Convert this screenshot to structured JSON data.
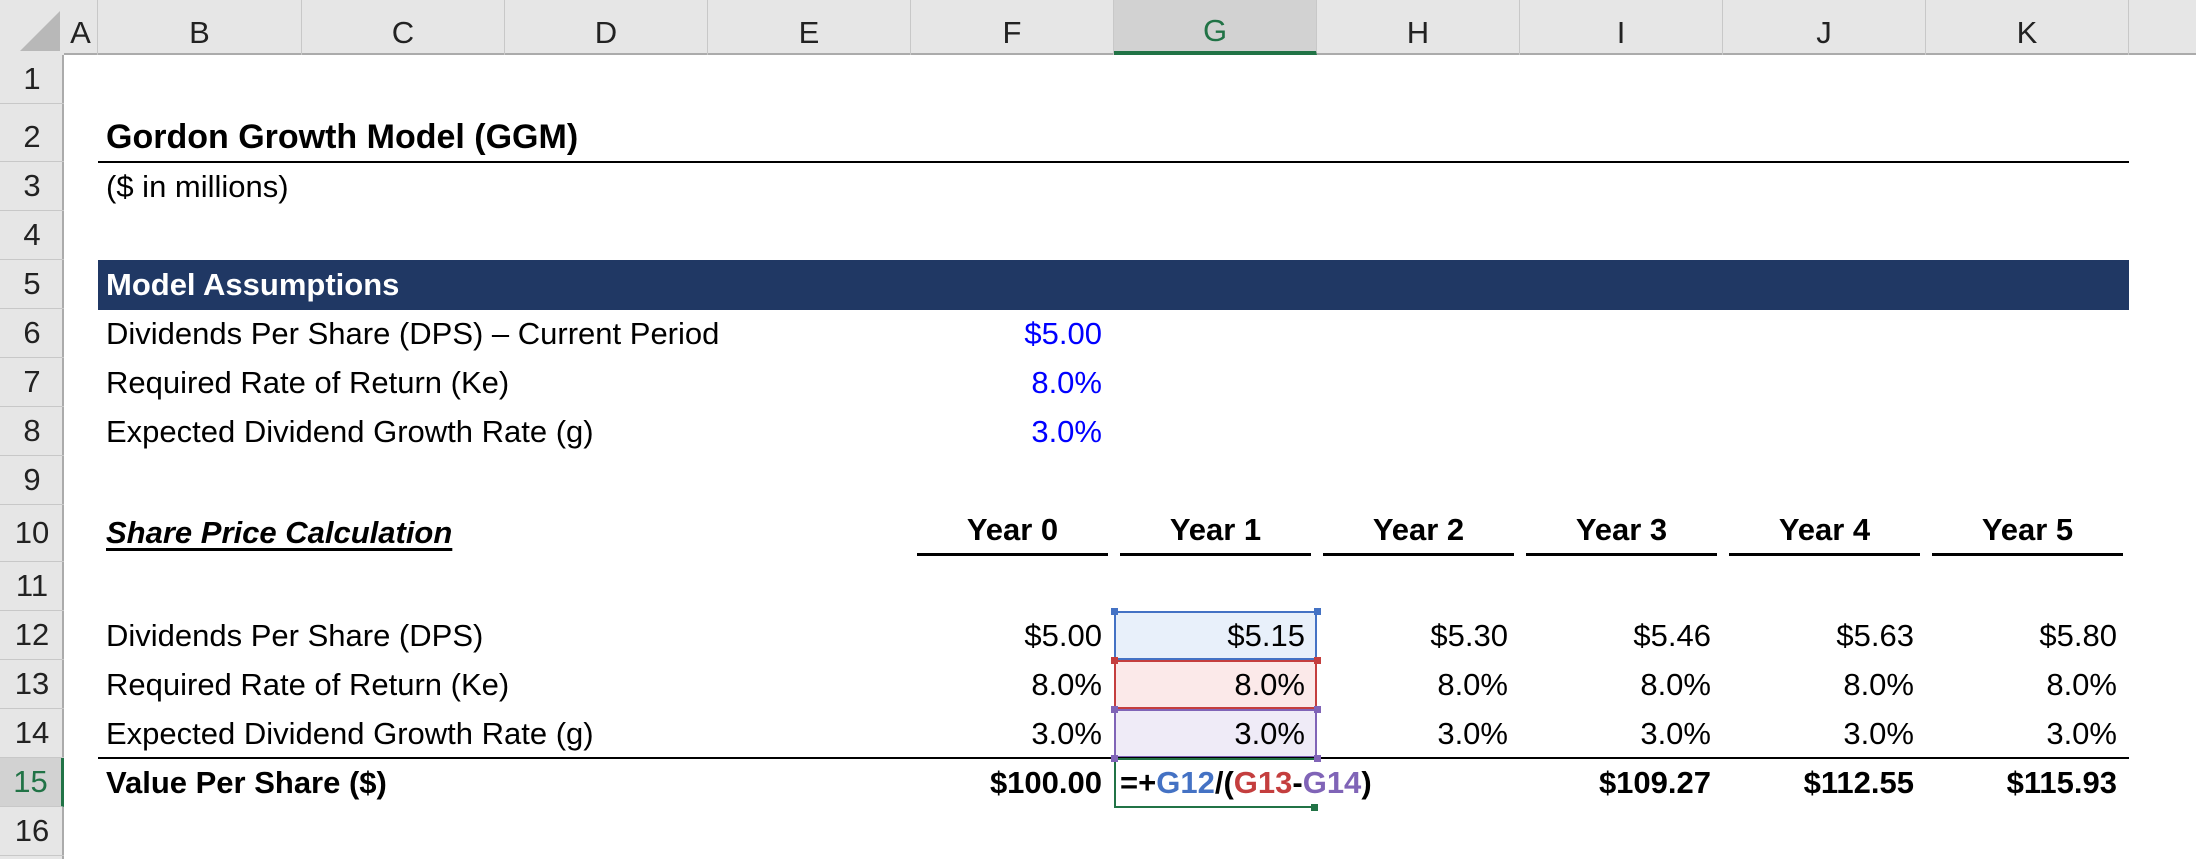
{
  "columns": [
    "A",
    "B",
    "C",
    "D",
    "E",
    "F",
    "G",
    "H",
    "I",
    "J",
    "K"
  ],
  "selected_column": "G",
  "rows": [
    "1",
    "2",
    "3",
    "4",
    "5",
    "6",
    "7",
    "8",
    "9",
    "10",
    "11",
    "12",
    "13",
    "14",
    "15",
    "16"
  ],
  "selected_row": "15",
  "title": "Gordon Growth Model (GGM)",
  "subtitle": "($ in millions)",
  "assumptions": {
    "header": "Model Assumptions",
    "items": [
      {
        "label": "Dividends Per Share (DPS) – Current Period",
        "value": "$5.00"
      },
      {
        "label": "Required Rate of Return (Ke)",
        "value": "8.0%"
      },
      {
        "label": "Expected Dividend Growth Rate (g)",
        "value": "3.0%"
      }
    ]
  },
  "calc": {
    "header": "Share Price Calculation",
    "years": [
      "Year 0",
      "Year 1",
      "Year 2",
      "Year 3",
      "Year 4",
      "Year 5"
    ],
    "rows": [
      {
        "label": "Dividends Per Share (DPS)",
        "values": [
          "$5.00",
          "$5.15",
          "$5.30",
          "$5.46",
          "$5.63",
          "$5.80"
        ]
      },
      {
        "label": "Required Rate of Return (Ke)",
        "values": [
          "8.0%",
          "8.0%",
          "8.0%",
          "8.0%",
          "8.0%",
          "8.0%"
        ]
      },
      {
        "label": "Expected Dividend Growth Rate (g)",
        "values": [
          "3.0%",
          "3.0%",
          "3.0%",
          "3.0%",
          "3.0%",
          "3.0%"
        ]
      }
    ],
    "total": {
      "label": "Value Per Share ($)",
      "values": [
        "$100.00",
        "",
        "",
        "$109.27",
        "$112.55",
        "$115.93"
      ]
    }
  },
  "active_cell": {
    "ref": "G15",
    "formula_parts": [
      {
        "text": "=+",
        "color": "default"
      },
      {
        "text": "G12",
        "color": "blue"
      },
      {
        "text": "/(",
        "color": "default"
      },
      {
        "text": "G13",
        "color": "red"
      },
      {
        "text": "-",
        "color": "default"
      },
      {
        "text": "G14",
        "color": "purple"
      },
      {
        "text": ")",
        "color": "default"
      }
    ]
  },
  "colors": {
    "band": "#203864",
    "input_blue": "#0000ff",
    "ref_blue": "#4472c4",
    "ref_red": "#c43e3e",
    "ref_purple": "#8064b7",
    "active_green": "#217346"
  }
}
